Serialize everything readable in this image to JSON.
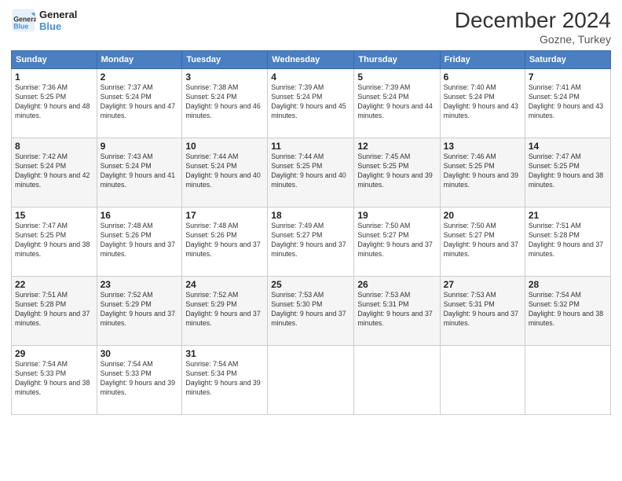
{
  "header": {
    "logo_line1": "General",
    "logo_line2": "Blue",
    "month_title": "December 2024",
    "subtitle": "Gozne, Turkey"
  },
  "weekdays": [
    "Sunday",
    "Monday",
    "Tuesday",
    "Wednesday",
    "Thursday",
    "Friday",
    "Saturday"
  ],
  "weeks": [
    [
      {
        "day": "1",
        "sunrise": "Sunrise: 7:36 AM",
        "sunset": "Sunset: 5:25 PM",
        "daylight": "Daylight: 9 hours and 48 minutes."
      },
      {
        "day": "2",
        "sunrise": "Sunrise: 7:37 AM",
        "sunset": "Sunset: 5:24 PM",
        "daylight": "Daylight: 9 hours and 47 minutes."
      },
      {
        "day": "3",
        "sunrise": "Sunrise: 7:38 AM",
        "sunset": "Sunset: 5:24 PM",
        "daylight": "Daylight: 9 hours and 46 minutes."
      },
      {
        "day": "4",
        "sunrise": "Sunrise: 7:39 AM",
        "sunset": "Sunset: 5:24 PM",
        "daylight": "Daylight: 9 hours and 45 minutes."
      },
      {
        "day": "5",
        "sunrise": "Sunrise: 7:39 AM",
        "sunset": "Sunset: 5:24 PM",
        "daylight": "Daylight: 9 hours and 44 minutes."
      },
      {
        "day": "6",
        "sunrise": "Sunrise: 7:40 AM",
        "sunset": "Sunset: 5:24 PM",
        "daylight": "Daylight: 9 hours and 43 minutes."
      },
      {
        "day": "7",
        "sunrise": "Sunrise: 7:41 AM",
        "sunset": "Sunset: 5:24 PM",
        "daylight": "Daylight: 9 hours and 43 minutes."
      }
    ],
    [
      {
        "day": "8",
        "sunrise": "Sunrise: 7:42 AM",
        "sunset": "Sunset: 5:24 PM",
        "daylight": "Daylight: 9 hours and 42 minutes."
      },
      {
        "day": "9",
        "sunrise": "Sunrise: 7:43 AM",
        "sunset": "Sunset: 5:24 PM",
        "daylight": "Daylight: 9 hours and 41 minutes."
      },
      {
        "day": "10",
        "sunrise": "Sunrise: 7:44 AM",
        "sunset": "Sunset: 5:24 PM",
        "daylight": "Daylight: 9 hours and 40 minutes."
      },
      {
        "day": "11",
        "sunrise": "Sunrise: 7:44 AM",
        "sunset": "Sunset: 5:25 PM",
        "daylight": "Daylight: 9 hours and 40 minutes."
      },
      {
        "day": "12",
        "sunrise": "Sunrise: 7:45 AM",
        "sunset": "Sunset: 5:25 PM",
        "daylight": "Daylight: 9 hours and 39 minutes."
      },
      {
        "day": "13",
        "sunrise": "Sunrise: 7:46 AM",
        "sunset": "Sunset: 5:25 PM",
        "daylight": "Daylight: 9 hours and 39 minutes."
      },
      {
        "day": "14",
        "sunrise": "Sunrise: 7:47 AM",
        "sunset": "Sunset: 5:25 PM",
        "daylight": "Daylight: 9 hours and 38 minutes."
      }
    ],
    [
      {
        "day": "15",
        "sunrise": "Sunrise: 7:47 AM",
        "sunset": "Sunset: 5:25 PM",
        "daylight": "Daylight: 9 hours and 38 minutes."
      },
      {
        "day": "16",
        "sunrise": "Sunrise: 7:48 AM",
        "sunset": "Sunset: 5:26 PM",
        "daylight": "Daylight: 9 hours and 37 minutes."
      },
      {
        "day": "17",
        "sunrise": "Sunrise: 7:48 AM",
        "sunset": "Sunset: 5:26 PM",
        "daylight": "Daylight: 9 hours and 37 minutes."
      },
      {
        "day": "18",
        "sunrise": "Sunrise: 7:49 AM",
        "sunset": "Sunset: 5:27 PM",
        "daylight": "Daylight: 9 hours and 37 minutes."
      },
      {
        "day": "19",
        "sunrise": "Sunrise: 7:50 AM",
        "sunset": "Sunset: 5:27 PM",
        "daylight": "Daylight: 9 hours and 37 minutes."
      },
      {
        "day": "20",
        "sunrise": "Sunrise: 7:50 AM",
        "sunset": "Sunset: 5:27 PM",
        "daylight": "Daylight: 9 hours and 37 minutes."
      },
      {
        "day": "21",
        "sunrise": "Sunrise: 7:51 AM",
        "sunset": "Sunset: 5:28 PM",
        "daylight": "Daylight: 9 hours and 37 minutes."
      }
    ],
    [
      {
        "day": "22",
        "sunrise": "Sunrise: 7:51 AM",
        "sunset": "Sunset: 5:28 PM",
        "daylight": "Daylight: 9 hours and 37 minutes."
      },
      {
        "day": "23",
        "sunrise": "Sunrise: 7:52 AM",
        "sunset": "Sunset: 5:29 PM",
        "daylight": "Daylight: 9 hours and 37 minutes."
      },
      {
        "day": "24",
        "sunrise": "Sunrise: 7:52 AM",
        "sunset": "Sunset: 5:29 PM",
        "daylight": "Daylight: 9 hours and 37 minutes."
      },
      {
        "day": "25",
        "sunrise": "Sunrise: 7:53 AM",
        "sunset": "Sunset: 5:30 PM",
        "daylight": "Daylight: 9 hours and 37 minutes."
      },
      {
        "day": "26",
        "sunrise": "Sunrise: 7:53 AM",
        "sunset": "Sunset: 5:31 PM",
        "daylight": "Daylight: 9 hours and 37 minutes."
      },
      {
        "day": "27",
        "sunrise": "Sunrise: 7:53 AM",
        "sunset": "Sunset: 5:31 PM",
        "daylight": "Daylight: 9 hours and 37 minutes."
      },
      {
        "day": "28",
        "sunrise": "Sunrise: 7:54 AM",
        "sunset": "Sunset: 5:32 PM",
        "daylight": "Daylight: 9 hours and 38 minutes."
      }
    ],
    [
      {
        "day": "29",
        "sunrise": "Sunrise: 7:54 AM",
        "sunset": "Sunset: 5:33 PM",
        "daylight": "Daylight: 9 hours and 38 minutes."
      },
      {
        "day": "30",
        "sunrise": "Sunrise: 7:54 AM",
        "sunset": "Sunset: 5:33 PM",
        "daylight": "Daylight: 9 hours and 39 minutes."
      },
      {
        "day": "31",
        "sunrise": "Sunrise: 7:54 AM",
        "sunset": "Sunset: 5:34 PM",
        "daylight": "Daylight: 9 hours and 39 minutes."
      },
      null,
      null,
      null,
      null
    ]
  ]
}
